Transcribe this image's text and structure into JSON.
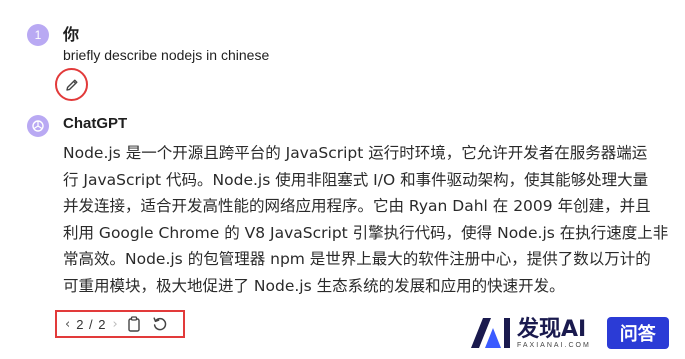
{
  "user": {
    "avatar_label": "1",
    "name": "你",
    "message": "briefly describe nodejs in chinese"
  },
  "assistant": {
    "name": "ChatGPT",
    "answer_lines": [
      "Node.js 是一个开源且跨平台的 JavaScript 运行时环境，它允许开发者在服务器端运",
      "行 JavaScript 代码。Node.js 使用非阻塞式 I/O 和事件驱动架构，使其能够处理大量",
      "并发连接，适合开发高性能的网络应用程序。它由 Ryan Dahl 在 2009 年创建，并且",
      "利用 Google Chrome 的 V8 JavaScript 引擎执行代码，使得 Node.js 在执行速度上非",
      "常高效。Node.js 的包管理器 npm 是世界上最大的软件注册中心，提供了数以万计的",
      "可重用模块，极大地促进了 Node.js 生态系统的发展和应用的快速开发。"
    ]
  },
  "toolbar": {
    "prev": "‹",
    "page": "2 / 2",
    "next": "›"
  },
  "icons": {
    "edit": "pencil-icon",
    "copy": "clipboard-icon",
    "regenerate": "refresh-icon",
    "gpt_logo": "openai-logo-icon"
  },
  "colors": {
    "highlight": "#e23a3a",
    "avatar": "#b9a9f3",
    "watermark_badge": "#2b3bd6"
  },
  "watermark": {
    "brand": "发现AI",
    "domain": "FAXIANAI.COM",
    "badge": "问答"
  }
}
